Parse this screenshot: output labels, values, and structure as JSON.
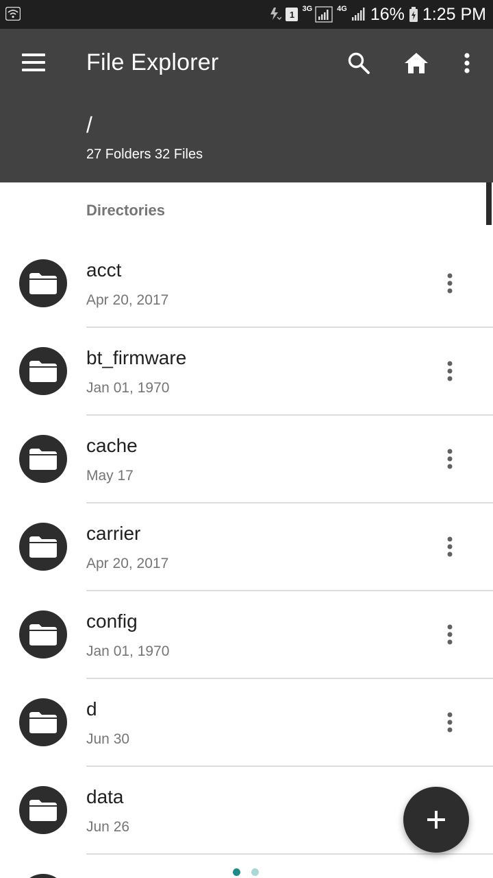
{
  "status_bar": {
    "network_tag_1": "3G",
    "network_tag_2": "4G",
    "sim_label": "1",
    "battery_percent": "16%",
    "time": "1:25 PM",
    "icons": [
      "wifi-icon",
      "data-transfer-icon",
      "sim-icon",
      "signal-icon",
      "battery-icon"
    ]
  },
  "app_bar": {
    "title": "File Explorer",
    "path": "/",
    "counts": "27 Folders 32 Files",
    "actions": [
      "search-icon",
      "home-icon",
      "more-vert-icon"
    ]
  },
  "section": {
    "label": "Directories"
  },
  "directories": [
    {
      "name": "acct",
      "date": "Apr 20, 2017"
    },
    {
      "name": "bt_firmware",
      "date": "Jan 01, 1970"
    },
    {
      "name": "cache",
      "date": "May 17"
    },
    {
      "name": "carrier",
      "date": "Apr 20, 2017"
    },
    {
      "name": "config",
      "date": "Jan 01, 1970"
    },
    {
      "name": "d",
      "date": "Jun 30"
    },
    {
      "name": "data",
      "date": "Jun 26"
    }
  ],
  "fab": {
    "icon": "plus-icon"
  },
  "page_indicator": {
    "count": 2,
    "active_index": 0
  },
  "colors": {
    "app_bar": "#424242",
    "status_bar": "#1f1f1f",
    "avatar": "#2d2d2d",
    "dot_active": "#1e8c86",
    "dot_inactive": "#a9d8d6"
  }
}
